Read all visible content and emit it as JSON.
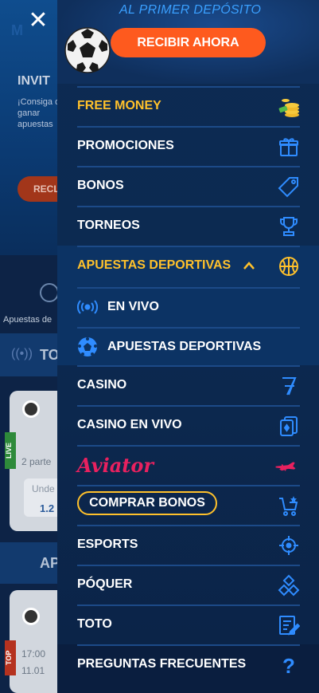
{
  "background": {
    "brand": "M",
    "invite_title": "INVIT",
    "invite_text": "¡Consiga de ganar apuestas",
    "button": "RECL",
    "sports_label": "Apuestas de",
    "row_title_1": "TO",
    "live_badge": "LIVE",
    "card_text": "2 parte",
    "card_box_a": "Unde",
    "card_box_b": "1.2",
    "row_title_2": "AP",
    "top_badge": "TOP",
    "card2_line1": "17:00",
    "card2_line2": "11.01"
  },
  "header": {
    "close_icon": "close-icon",
    "deposit_text": "AL PRIMER DEPÓSITO",
    "receive_button": "RECIBIR AHORA",
    "ball_image": "soccer-ball"
  },
  "menu": {
    "free_money": "FREE MONEY",
    "promociones": "PROMOCIONES",
    "bonos": "BONOS",
    "torneos": "TORNEOS",
    "apuestas_deportivas": "APUESTAS DEPORTIVAS",
    "en_vivo": "EN VIVO",
    "apuestas_deportivas_sub": "APUESTAS DEPORTIVAS",
    "casino": "CASINO",
    "casino_en_vivo": "CASINO EN VIVO",
    "aviator": "Aviator",
    "comprar_bonos": "COMPRAR BONOS",
    "esports": "ESPORTS",
    "poquer": "PÓQUER",
    "toto": "TOTO",
    "faq": "PREGUNTAS FRECUENTES"
  },
  "colors": {
    "accent_blue": "#2f8cff",
    "accent_yellow": "#ffc12b",
    "cta_orange": "#fe5a1e",
    "aviator_red": "#e8215f"
  }
}
